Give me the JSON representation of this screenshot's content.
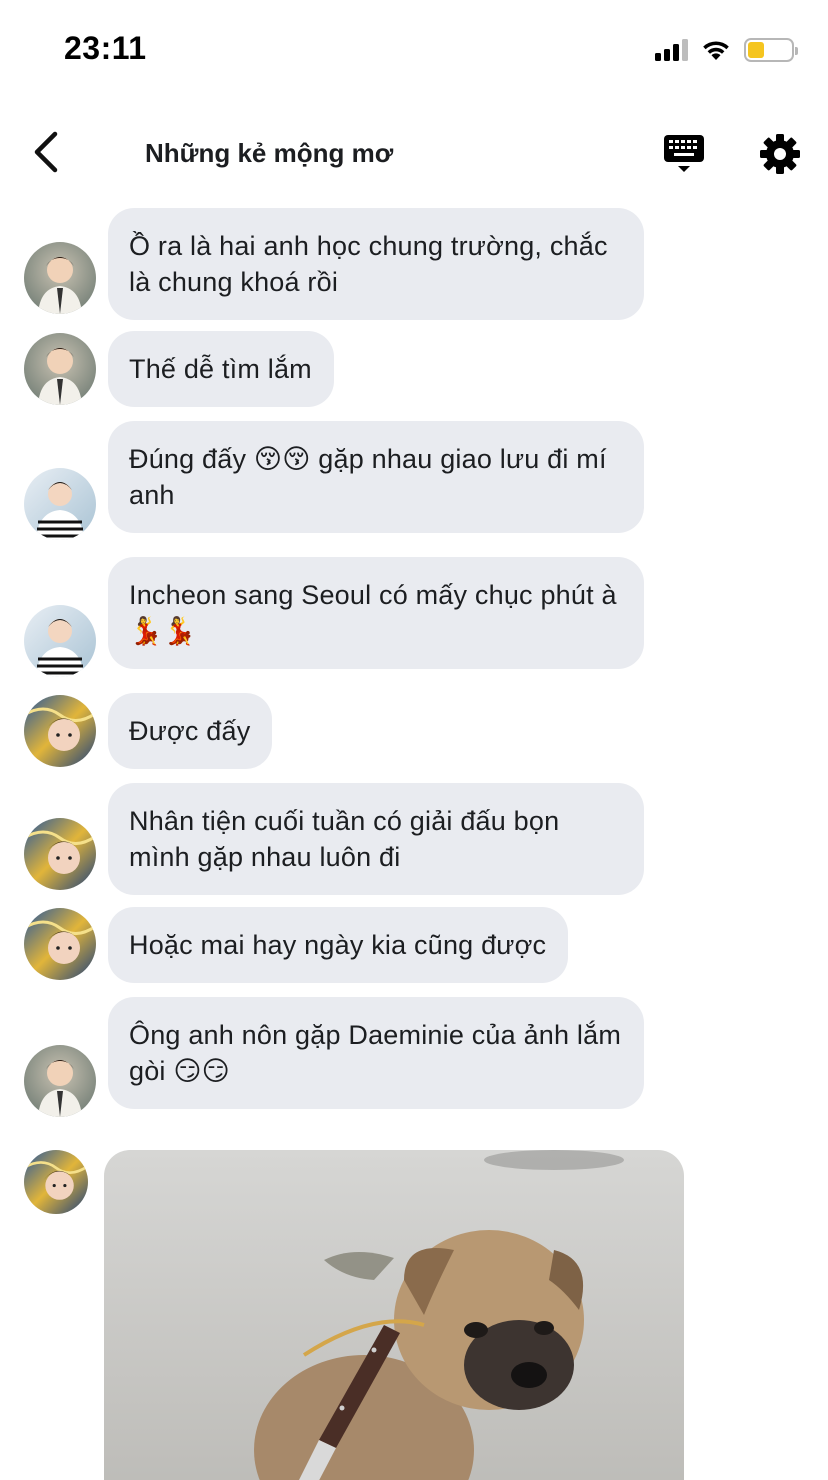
{
  "status_bar": {
    "time": "23:11",
    "battery_color": "#f5c51f"
  },
  "header": {
    "title": "Những kẻ mộng mơ",
    "back_icon": "chevron-left-icon",
    "keyboard_icon": "keyboard-icon",
    "settings_icon": "gear-icon"
  },
  "messages": [
    {
      "text": "Ồ ra là hai anh học chung trường, chắc là chung khoá rồi",
      "avatar": "boy-cardigan"
    },
    {
      "text": "Thế dễ tìm lắm",
      "avatar": "boy-cardigan"
    },
    {
      "text": "Đúng đấy 😚😚 gặp nhau giao lưu đi mí anh",
      "avatar": "boy-striped"
    },
    {
      "text": "Incheon sang Seoul có mấy chục phút à 💃💃",
      "avatar": "boy-striped"
    },
    {
      "text": "Được đấy",
      "avatar": "boy-starry"
    },
    {
      "text": "Nhân tiện cuối tuần có giải đấu bọn mình gặp nhau luôn đi",
      "avatar": "boy-starry"
    },
    {
      "text": "Hoặc mai hay ngày kia cũng được",
      "avatar": "boy-starry"
    },
    {
      "text": "Ông anh nôn gặp Daeminie của ảnh lắm gòi 😏😏",
      "avatar": "boy-cardigan"
    }
  ],
  "photo_message": {
    "avatar": "boy-starry",
    "image": "puppy-with-knife"
  },
  "colors": {
    "bubble": "#e9ebf0",
    "text": "#1c1e21"
  }
}
